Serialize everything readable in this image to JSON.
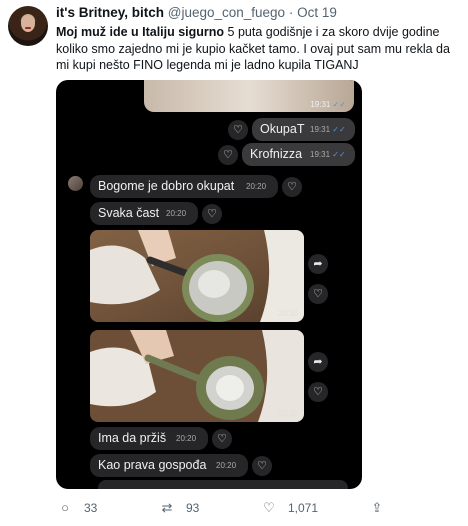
{
  "author": {
    "name": "it's Britney, bitch",
    "handle": "@juego_con_fuego",
    "separator": "·",
    "date": "Oct 19"
  },
  "tweet": {
    "bold_text": "Moj muž ide u Italiju sigurno",
    "text": " 5 puta godišnje i za skoro dvije godine koliko smo zajedno mi je kupio kačket tamo. I ovaj put sam mu rekla da mi kupi nešto FINO legenda mi je ladno kupila TIGANJ"
  },
  "chat": {
    "top_time": "19:31",
    "messages": [
      {
        "text": "OkupaT",
        "time": "19:31",
        "direction": "out"
      },
      {
        "text": "Krofnizza",
        "time": "19:31",
        "direction": "out"
      },
      {
        "text": "Bogome je dobro okupat",
        "time": "20:20",
        "direction": "in"
      },
      {
        "text": "Svaka čast",
        "time": "20:20",
        "direction": "in"
      },
      {
        "text": "Ima da pržiš",
        "time": "20:20",
        "direction": "in"
      },
      {
        "text": "Kao prava gospođa",
        "time": "20:20",
        "direction": "in"
      }
    ],
    "photos": [
      {
        "time": "20:20"
      },
      {
        "time": "20:20"
      }
    ],
    "read_check": "✓✓"
  },
  "icons": {
    "heart": "heart-icon",
    "share": "share-icon",
    "reply": "reply-icon",
    "retweet": "retweet-icon",
    "like": "like-icon",
    "upload": "upload-icon"
  },
  "actions": {
    "replies": "33",
    "retweets": "93",
    "likes": "1,071"
  },
  "colors": {
    "chat_background": "#000000",
    "incoming_bubble": "#262628",
    "outgoing_bubble": "#3a3a3c",
    "read_check": "#5e8fd6",
    "muted_text": "#536471"
  }
}
